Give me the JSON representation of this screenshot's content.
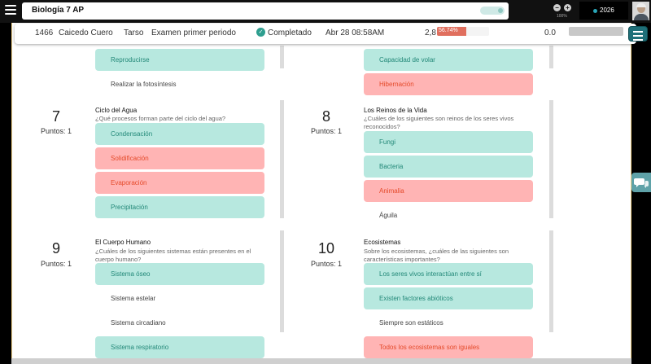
{
  "app": {
    "title": "Biología 7 AP",
    "zoom_label": "100%",
    "year": "2026"
  },
  "infobar": {
    "id": "1466",
    "student": "Caicedo Cuero",
    "first_name": "Tarso",
    "exam": "Examen primer periodo",
    "status": "Completado",
    "date": "Abr 28 08:58AM",
    "grade": "2,8",
    "percent": "56.74%",
    "percent_value": 56.74,
    "extra_score": "0.0",
    "colors": {
      "accent": "#1f6f78",
      "correct": "#b7e8df",
      "wrong": "#ffb4b4",
      "score_fill": "#e06f5e"
    }
  },
  "questions": [
    {
      "number": "",
      "points": "",
      "title": "",
      "prompt": "",
      "options": [
        {
          "text": "Reproducirse",
          "state": "correct"
        },
        {
          "text": "Realizar la fotosíntesis",
          "state": "neutral"
        }
      ]
    },
    {
      "number": "",
      "points": "",
      "title": "",
      "prompt": "",
      "options": [
        {
          "text": "Capacidad de volar",
          "state": "correct"
        },
        {
          "text": "Hibernación",
          "state": "wrong"
        }
      ]
    },
    {
      "number": "7",
      "points": "Puntos: 1",
      "title": "Ciclo del Agua",
      "prompt": "¿Qué procesos forman parte del ciclo del agua?",
      "options": [
        {
          "text": "Condensación",
          "state": "correct"
        },
        {
          "text": "Solidificación",
          "state": "wrong"
        },
        {
          "text": "Evaporación",
          "state": "wrong"
        },
        {
          "text": "Precipitación",
          "state": "correct"
        }
      ]
    },
    {
      "number": "8",
      "points": "Puntos: 1",
      "title": "Los Reinos de la Vida",
      "prompt": "¿Cuáles de los siguientes son reinos de los seres vivos reconocidos?",
      "options": [
        {
          "text": "Fungi",
          "state": "correct"
        },
        {
          "text": "Bacteria",
          "state": "correct"
        },
        {
          "text": "Animalia",
          "state": "wrong"
        },
        {
          "text": "Águila",
          "state": "neutral"
        }
      ]
    },
    {
      "number": "9",
      "points": "Puntos: 1",
      "title": "El Cuerpo Humano",
      "prompt": "¿Cuáles de los siguientes sistemas están presentes en el cuerpo humano?",
      "options": [
        {
          "text": "Sistema óseo",
          "state": "correct"
        },
        {
          "text": "Sistema estelar",
          "state": "neutral"
        },
        {
          "text": "Sistema circadiano",
          "state": "neutral"
        },
        {
          "text": "Sistema respiratorio",
          "state": "correct"
        }
      ]
    },
    {
      "number": "10",
      "points": "Puntos: 1",
      "title": "Ecosistemas",
      "prompt": "Sobre los ecosistemas, ¿cuáles de las siguientes son características importantes?",
      "options": [
        {
          "text": "Los seres vivos interactúan entre sí",
          "state": "correct"
        },
        {
          "text": "Existen factores abióticos",
          "state": "correct"
        },
        {
          "text": "Siempre son estáticos",
          "state": "neutral"
        },
        {
          "text": "Todos los ecosistemas son iguales",
          "state": "wrong"
        }
      ]
    }
  ],
  "icons": {
    "hamburger": "hamburger-icon",
    "status": "check-circle-icon",
    "menu": "menu-icon",
    "chat": "chat-bubbles-icon"
  }
}
